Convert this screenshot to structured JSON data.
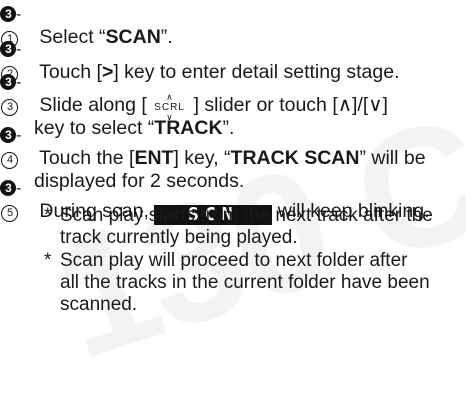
{
  "watermark": "130 C",
  "steps": [
    {
      "marker_main": "3",
      "marker_sub": "1",
      "text_before": " Select “",
      "bold": "SCAN",
      "text_after": "”."
    },
    {
      "marker_main": "3",
      "marker_sub": "2",
      "text_before": " Touch [",
      "bracket": ">",
      "text_after": "] key to enter detail setting stage."
    },
    {
      "marker_main": "3",
      "marker_sub": "3",
      "line1_before": " Slide along [ ",
      "slider_label": "SCRL",
      "line1_after": " ] slider or touch [∧]/[∨]",
      "line2_before": "key to select “",
      "bold": "TRACK",
      "line2_after": "”."
    },
    {
      "marker_main": "3",
      "marker_sub": "4",
      "line1_before": " Touch the [",
      "key": "ENT",
      "line1_mid": "] key, “",
      "bold": "TRACK SCAN",
      "line1_after": "” will be",
      "line2": "displayed for 2 seconds."
    },
    {
      "marker_main": "3",
      "marker_sub": "5",
      "text_before": " During scan, ",
      "display_indicator": "SCN",
      "text_after": " will keep blinking."
    }
  ],
  "notes": [
    {
      "star": "*",
      "line1": "Scan play starts from the next track after the",
      "line2": "track currently being played."
    },
    {
      "star": "*",
      "line1": "Scan play will proceed to next folder after",
      "line2": "all the tracks in the current folder have been",
      "line3": "scanned."
    }
  ]
}
